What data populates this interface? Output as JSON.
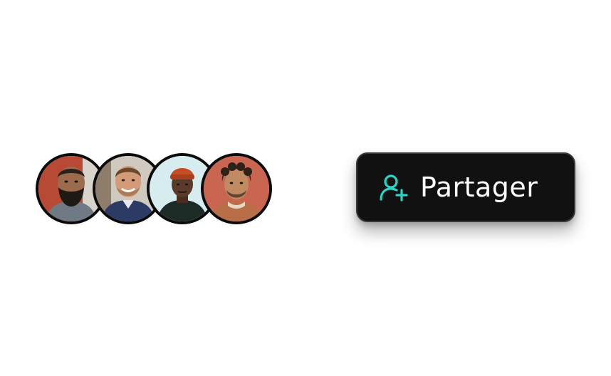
{
  "avatars": [
    {
      "name": "avatar-1",
      "bg": "#b84a35",
      "skin": "#9c6b4e",
      "hair": "#2a211c",
      "shirt": "#6f7a84"
    },
    {
      "name": "avatar-2",
      "bg": "#cfc9c0",
      "skin": "#d49b7a",
      "hair": "#6b4a2c",
      "shirt": "#2c3a66"
    },
    {
      "name": "avatar-3",
      "bg": "#d7ecef",
      "skin": "#5a3a28",
      "hair": "#c24d26",
      "shirt": "#1d2b26"
    },
    {
      "name": "avatar-4",
      "bg": "#c96551",
      "skin": "#c08a63",
      "hair": "#2d2118",
      "shirt": "#b86e47"
    }
  ],
  "share_button": {
    "label": "Partager",
    "icon": "user-plus-icon",
    "icon_color": "#2ed3c4",
    "background": "#111111"
  }
}
